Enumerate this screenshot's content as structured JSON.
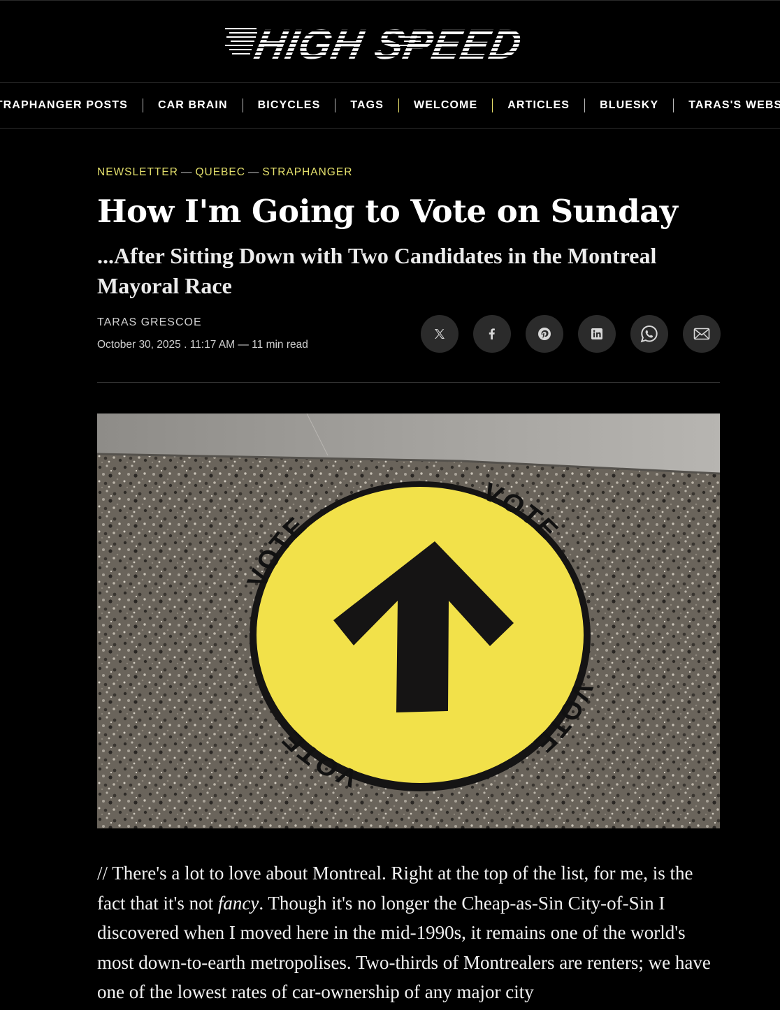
{
  "site": {
    "logo_text": "HIGH SPEED"
  },
  "nav": {
    "items": [
      {
        "label": "STRAPHANGER POSTS"
      },
      {
        "label": "CAR BRAIN"
      },
      {
        "label": "BICYCLES"
      },
      {
        "label": "TAGS"
      },
      {
        "label": "WELCOME"
      },
      {
        "label": "ARTICLES"
      },
      {
        "label": "BLUESKY"
      },
      {
        "label": "TARAS'S WEBSITE"
      }
    ]
  },
  "article": {
    "tags": [
      "NEWSLETTER",
      "QUEBEC",
      "STRAPHANGER"
    ],
    "tag_separator": "—",
    "title": "How I'm Going to Vote on Sunday",
    "subtitle": "...After Sitting Down with Two Candidates in the Montreal Mayoral Race",
    "author": "TARAS GRESCOE",
    "date": "October 30, 2025 . 11:17 AM",
    "read_time": "11 min read",
    "meta_separator": "—",
    "share": [
      {
        "name": "x",
        "icon": "x-icon"
      },
      {
        "name": "facebook",
        "icon": "facebook-icon"
      },
      {
        "name": "pinterest",
        "icon": "pinterest-icon"
      },
      {
        "name": "linkedin",
        "icon": "linkedin-icon"
      },
      {
        "name": "whatsapp",
        "icon": "whatsapp-icon"
      },
      {
        "name": "email",
        "icon": "mail-icon"
      }
    ],
    "image": {
      "sticker_word": "VOTE",
      "sticker_color": "#f2e14a"
    },
    "body": {
      "part1": "// There's a lot to love about Montreal. Right at the top of the list, for me, is the fact that it's not ",
      "emphasis": "fancy",
      "part2": ". Though it's no longer the Cheap-as-Sin City-of-Sin I discovered when I moved here in the mid-1990s, it remains one of the world's most down-to-earth metropolises. Two-thirds of Montrealers are renters; we have one of the lowest rates of car-ownership of any major city"
    }
  },
  "colors": {
    "accent": "#e4e06c",
    "background": "#000000",
    "button_bg": "#2b2b2b"
  }
}
